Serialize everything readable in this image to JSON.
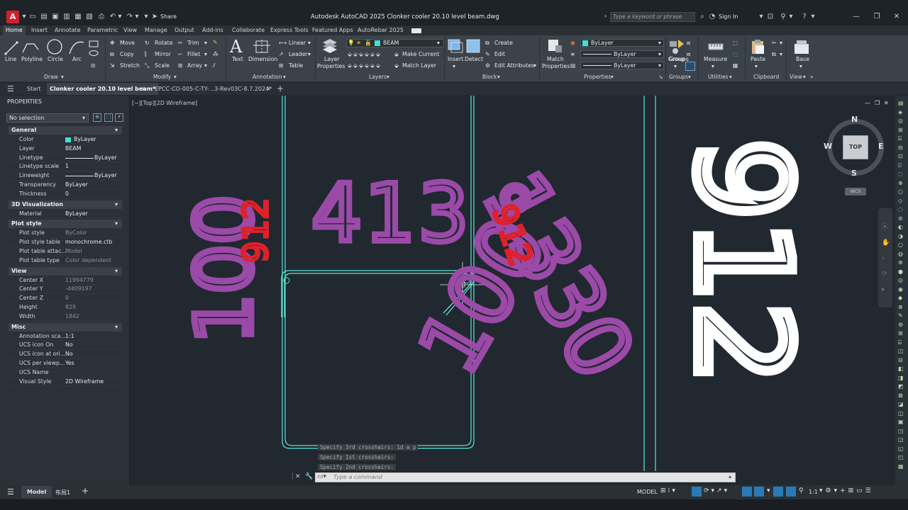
{
  "titlebar": {
    "app_letter": "A",
    "share_label": "Share",
    "title": "Autodesk AutoCAD 2025    Clonker cooler 20.10 level beam.dwg",
    "search_placeholder": "Type a keyword or phrase",
    "signin_label": "Sign In"
  },
  "ribbon_tabs": [
    "Home",
    "Insert",
    "Annotate",
    "Parametric",
    "View",
    "Manage",
    "Output",
    "Add-ins",
    "Collaborate",
    "Express Tools",
    "Featured Apps",
    "AutoRebar 2025"
  ],
  "ribbon": {
    "draw": {
      "line": "Line",
      "polyline": "Polyline",
      "circle": "Circle",
      "arc": "Arc",
      "label": "Draw"
    },
    "modify": {
      "move": "Move",
      "rotate": "Rotate",
      "trim": "Trim",
      "copy": "Copy",
      "mirror": "Mirror",
      "fillet": "Fillet",
      "stretch": "Stretch",
      "scale": "Scale",
      "array": "Array",
      "label": "Modify"
    },
    "annotation": {
      "text": "Text",
      "dimension": "Dimension",
      "linear": "Linear",
      "leader": "Leader",
      "table": "Table",
      "label": "Annotation"
    },
    "layers": {
      "layer_properties_1": "Layer",
      "layer_properties_2": "Properties",
      "current_layer": "BEAM",
      "make_current": "Make Current",
      "match_layer": "Match Layer",
      "label": "Layers"
    },
    "block": {
      "insert": "Insert",
      "detect": "Detect",
      "create": "Create",
      "edit": "Edit",
      "edit_attributes": "Edit Attributes",
      "label": "Block"
    },
    "properties": {
      "match_1": "Match",
      "match_2": "Properties",
      "color": "ByLayer",
      "linetype": "ByLayer",
      "lineweight": "ByLayer",
      "label": "Properties"
    },
    "groups": {
      "group": "Group",
      "label": "Groups"
    },
    "utilities": {
      "measure": "Measure",
      "label": "Utilities"
    },
    "clipboard": {
      "paste": "Paste",
      "label": "Clipboard"
    },
    "view": {
      "base": "Base",
      "label": "View"
    }
  },
  "file_tabs": {
    "start": "Start",
    "active": "Clonker cooler 20.10 level beam*",
    "other": "EPCC-CO-005-C-TY-...3-Rev03C-8.7.2024*"
  },
  "properties_palette": {
    "title": "PROPERTIES",
    "selection": "No selection",
    "general": {
      "header": "General",
      "rows": [
        [
          "Color",
          "ByLayer"
        ],
        [
          "Layer",
          "BEAM"
        ],
        [
          "Linetype",
          "ByLayer"
        ],
        [
          "Linetype scale",
          "1"
        ],
        [
          "Lineweight",
          "ByLayer"
        ],
        [
          "Transparency",
          "ByLayer"
        ],
        [
          "Thickness",
          "0"
        ]
      ]
    },
    "viz3d": {
      "header": "3D Visualization",
      "rows": [
        [
          "Material",
          "ByLayer"
        ]
      ]
    },
    "plot": {
      "header": "Plot style",
      "rows": [
        [
          "Plot style",
          "ByColor"
        ],
        [
          "Plot style table",
          "monochrome.ctb"
        ],
        [
          "Plot table attac...",
          "Model"
        ],
        [
          "Plot table type",
          "Color dependent"
        ]
      ]
    },
    "view": {
      "header": "View",
      "rows": [
        [
          "Center X",
          "11994779"
        ],
        [
          "Center Y",
          "-4409197"
        ],
        [
          "Center Z",
          "0"
        ],
        [
          "Height",
          "829"
        ],
        [
          "Width",
          "1842"
        ]
      ]
    },
    "misc": {
      "header": "Misc",
      "rows": [
        [
          "Annotation sca...",
          "1:1"
        ],
        [
          "UCS icon On",
          "No"
        ],
        [
          "UCS icon at ori...",
          "No"
        ],
        [
          "UCS per viewp...",
          "Yes"
        ],
        [
          "UCS Name",
          ""
        ],
        [
          "Visual Style",
          "2D Wireframe"
        ]
      ]
    }
  },
  "viewport": {
    "label": "[−][Top][2D Wireframe]",
    "compass": {
      "n": "N",
      "s": "S",
      "e": "E",
      "w": "W",
      "top": "TOP",
      "wcs": "WCS"
    },
    "handwriting": {
      "a": "413",
      "b": "100",
      "c": "912",
      "d": "1330",
      "e": "100°",
      "f": "912",
      "g": "912"
    }
  },
  "command": {
    "history": [
      "Specify 3rd crosshairs: 1d a p",
      "Specify 1st crosshairs:",
      "Specify 2nd crosshairs:"
    ],
    "placeholder": "Type a command"
  },
  "statusbar": {
    "model_tab": "Model",
    "layout_tab": "布局1",
    "model_label": "MODEL",
    "scale": "1:1"
  },
  "colors": {
    "accent": "#2a7ab8",
    "magenta": "#9b4aa8",
    "red_ink": "#e0202a",
    "beam_line": "#5ae6d6"
  }
}
